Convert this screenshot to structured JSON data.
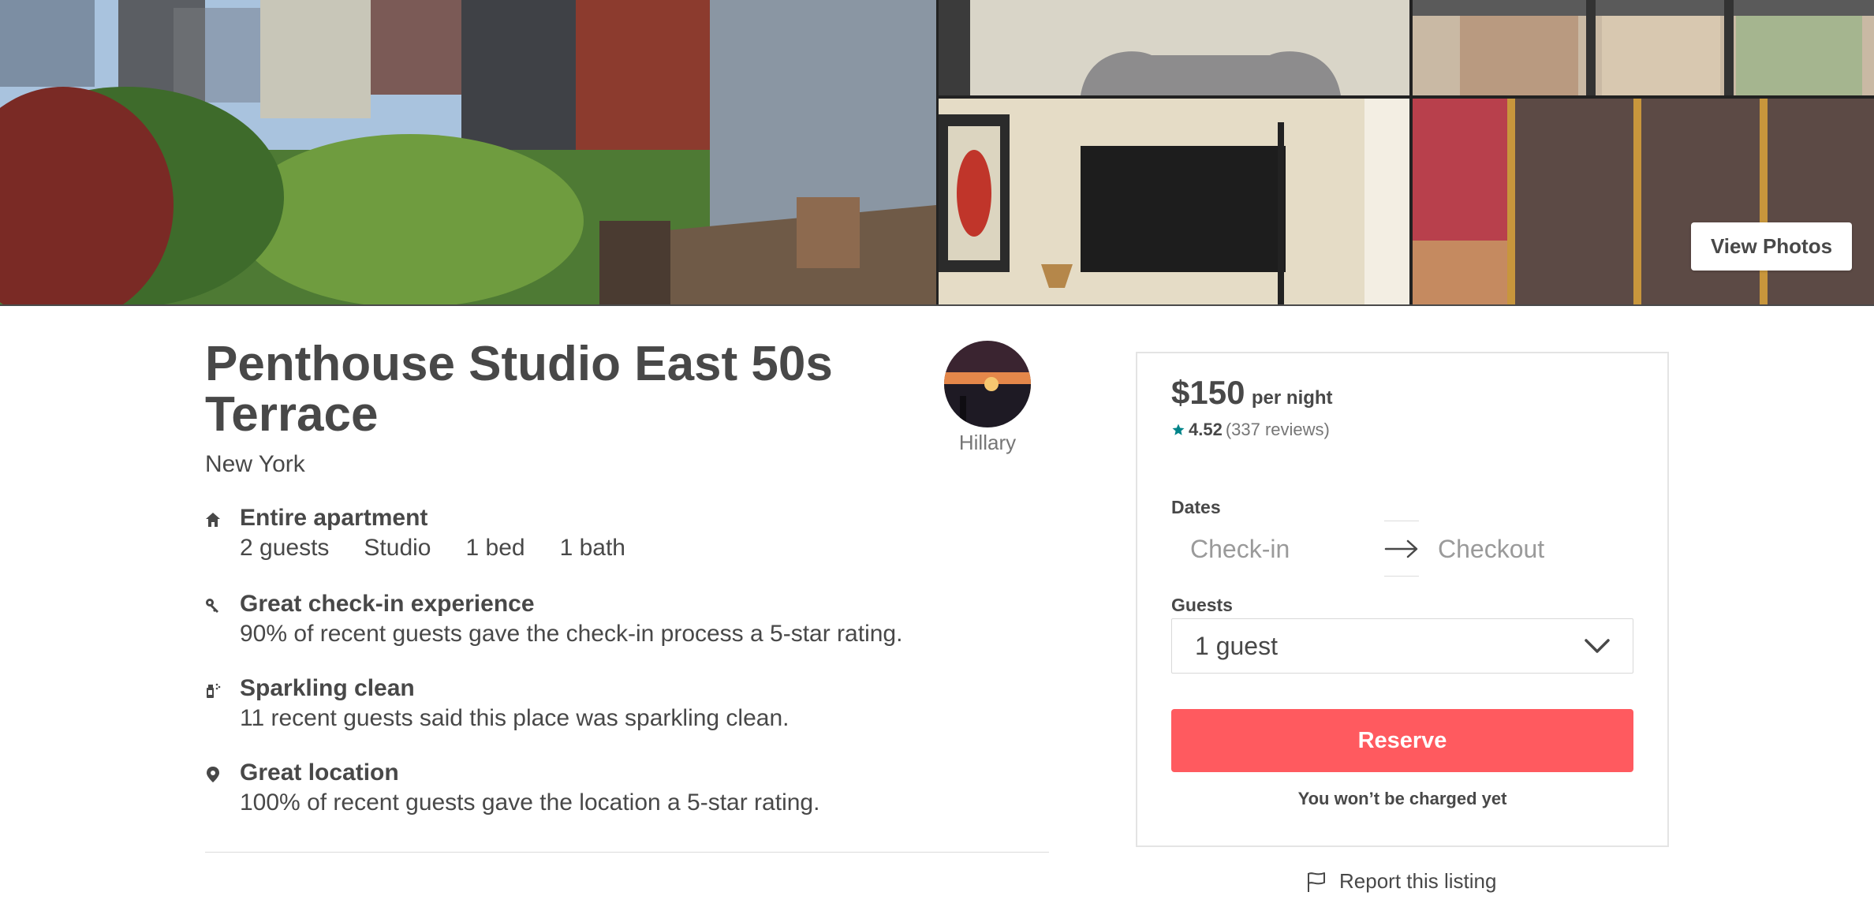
{
  "gallery": {
    "photos": [
      {
        "name": "rooftop terrace with city view"
      },
      {
        "name": "headboard and wallpaper"
      },
      {
        "name": "window view"
      },
      {
        "name": "wall mounted tv"
      },
      {
        "name": "gold framed screen"
      }
    ],
    "view_photos_label": "View Photos"
  },
  "listing": {
    "title": "Penthouse Studio East 50s Terrace",
    "city": "New York",
    "host_name": "Hillary",
    "features": [
      {
        "icon": "home-icon",
        "heading": "Entire apartment",
        "specs": [
          "2 guests",
          "Studio",
          "1 bed",
          "1 bath"
        ]
      },
      {
        "icon": "key-icon",
        "heading": "Great check-in experience",
        "description": "90% of recent guests gave the check-in process a 5-star rating."
      },
      {
        "icon": "spray-icon",
        "heading": "Sparkling clean",
        "description": "11 recent guests said this place was sparkling clean."
      },
      {
        "icon": "location-pin-icon",
        "heading": "Great location",
        "description": "100% of recent guests gave the location a 5-star rating."
      }
    ]
  },
  "booking": {
    "price": "$150",
    "per_night": "per night",
    "rating": "4.52",
    "reviews": "(337 reviews)",
    "dates_label": "Dates",
    "checkin_placeholder": "Check-in",
    "checkout_placeholder": "Checkout",
    "guests_label": "Guests",
    "guests_value": "1 guest",
    "reserve_label": "Reserve",
    "no_charge_note": "You won’t be charged yet",
    "report_label": "Report this listing"
  },
  "colors": {
    "accent": "#ff5a5f",
    "star": "#008489",
    "text": "#484848",
    "muted": "#767676"
  }
}
